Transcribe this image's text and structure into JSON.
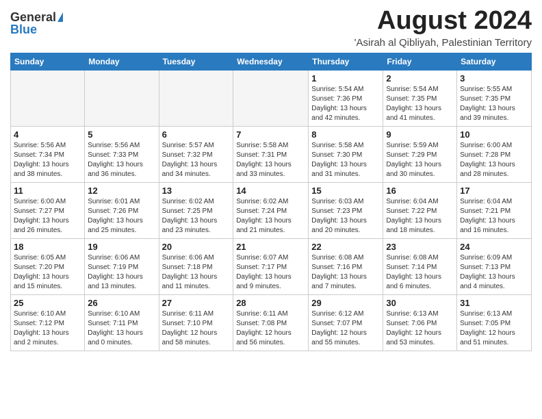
{
  "header": {
    "logo_general": "General",
    "logo_blue": "Blue",
    "title": "August 2024",
    "subtitle": "'Asirah al Qibliyah, Palestinian Territory"
  },
  "weekdays": [
    "Sunday",
    "Monday",
    "Tuesday",
    "Wednesday",
    "Thursday",
    "Friday",
    "Saturday"
  ],
  "weeks": [
    [
      {
        "day": "",
        "info": ""
      },
      {
        "day": "",
        "info": ""
      },
      {
        "day": "",
        "info": ""
      },
      {
        "day": "",
        "info": ""
      },
      {
        "day": "1",
        "info": "Sunrise: 5:54 AM\nSunset: 7:36 PM\nDaylight: 13 hours\nand 42 minutes."
      },
      {
        "day": "2",
        "info": "Sunrise: 5:54 AM\nSunset: 7:35 PM\nDaylight: 13 hours\nand 41 minutes."
      },
      {
        "day": "3",
        "info": "Sunrise: 5:55 AM\nSunset: 7:35 PM\nDaylight: 13 hours\nand 39 minutes."
      }
    ],
    [
      {
        "day": "4",
        "info": "Sunrise: 5:56 AM\nSunset: 7:34 PM\nDaylight: 13 hours\nand 38 minutes."
      },
      {
        "day": "5",
        "info": "Sunrise: 5:56 AM\nSunset: 7:33 PM\nDaylight: 13 hours\nand 36 minutes."
      },
      {
        "day": "6",
        "info": "Sunrise: 5:57 AM\nSunset: 7:32 PM\nDaylight: 13 hours\nand 34 minutes."
      },
      {
        "day": "7",
        "info": "Sunrise: 5:58 AM\nSunset: 7:31 PM\nDaylight: 13 hours\nand 33 minutes."
      },
      {
        "day": "8",
        "info": "Sunrise: 5:58 AM\nSunset: 7:30 PM\nDaylight: 13 hours\nand 31 minutes."
      },
      {
        "day": "9",
        "info": "Sunrise: 5:59 AM\nSunset: 7:29 PM\nDaylight: 13 hours\nand 30 minutes."
      },
      {
        "day": "10",
        "info": "Sunrise: 6:00 AM\nSunset: 7:28 PM\nDaylight: 13 hours\nand 28 minutes."
      }
    ],
    [
      {
        "day": "11",
        "info": "Sunrise: 6:00 AM\nSunset: 7:27 PM\nDaylight: 13 hours\nand 26 minutes."
      },
      {
        "day": "12",
        "info": "Sunrise: 6:01 AM\nSunset: 7:26 PM\nDaylight: 13 hours\nand 25 minutes."
      },
      {
        "day": "13",
        "info": "Sunrise: 6:02 AM\nSunset: 7:25 PM\nDaylight: 13 hours\nand 23 minutes."
      },
      {
        "day": "14",
        "info": "Sunrise: 6:02 AM\nSunset: 7:24 PM\nDaylight: 13 hours\nand 21 minutes."
      },
      {
        "day": "15",
        "info": "Sunrise: 6:03 AM\nSunset: 7:23 PM\nDaylight: 13 hours\nand 20 minutes."
      },
      {
        "day": "16",
        "info": "Sunrise: 6:04 AM\nSunset: 7:22 PM\nDaylight: 13 hours\nand 18 minutes."
      },
      {
        "day": "17",
        "info": "Sunrise: 6:04 AM\nSunset: 7:21 PM\nDaylight: 13 hours\nand 16 minutes."
      }
    ],
    [
      {
        "day": "18",
        "info": "Sunrise: 6:05 AM\nSunset: 7:20 PM\nDaylight: 13 hours\nand 15 minutes."
      },
      {
        "day": "19",
        "info": "Sunrise: 6:06 AM\nSunset: 7:19 PM\nDaylight: 13 hours\nand 13 minutes."
      },
      {
        "day": "20",
        "info": "Sunrise: 6:06 AM\nSunset: 7:18 PM\nDaylight: 13 hours\nand 11 minutes."
      },
      {
        "day": "21",
        "info": "Sunrise: 6:07 AM\nSunset: 7:17 PM\nDaylight: 13 hours\nand 9 minutes."
      },
      {
        "day": "22",
        "info": "Sunrise: 6:08 AM\nSunset: 7:16 PM\nDaylight: 13 hours\nand 7 minutes."
      },
      {
        "day": "23",
        "info": "Sunrise: 6:08 AM\nSunset: 7:14 PM\nDaylight: 13 hours\nand 6 minutes."
      },
      {
        "day": "24",
        "info": "Sunrise: 6:09 AM\nSunset: 7:13 PM\nDaylight: 13 hours\nand 4 minutes."
      }
    ],
    [
      {
        "day": "25",
        "info": "Sunrise: 6:10 AM\nSunset: 7:12 PM\nDaylight: 13 hours\nand 2 minutes."
      },
      {
        "day": "26",
        "info": "Sunrise: 6:10 AM\nSunset: 7:11 PM\nDaylight: 13 hours\nand 0 minutes."
      },
      {
        "day": "27",
        "info": "Sunrise: 6:11 AM\nSunset: 7:10 PM\nDaylight: 12 hours\nand 58 minutes."
      },
      {
        "day": "28",
        "info": "Sunrise: 6:11 AM\nSunset: 7:08 PM\nDaylight: 12 hours\nand 56 minutes."
      },
      {
        "day": "29",
        "info": "Sunrise: 6:12 AM\nSunset: 7:07 PM\nDaylight: 12 hours\nand 55 minutes."
      },
      {
        "day": "30",
        "info": "Sunrise: 6:13 AM\nSunset: 7:06 PM\nDaylight: 12 hours\nand 53 minutes."
      },
      {
        "day": "31",
        "info": "Sunrise: 6:13 AM\nSunset: 7:05 PM\nDaylight: 12 hours\nand 51 minutes."
      }
    ]
  ]
}
